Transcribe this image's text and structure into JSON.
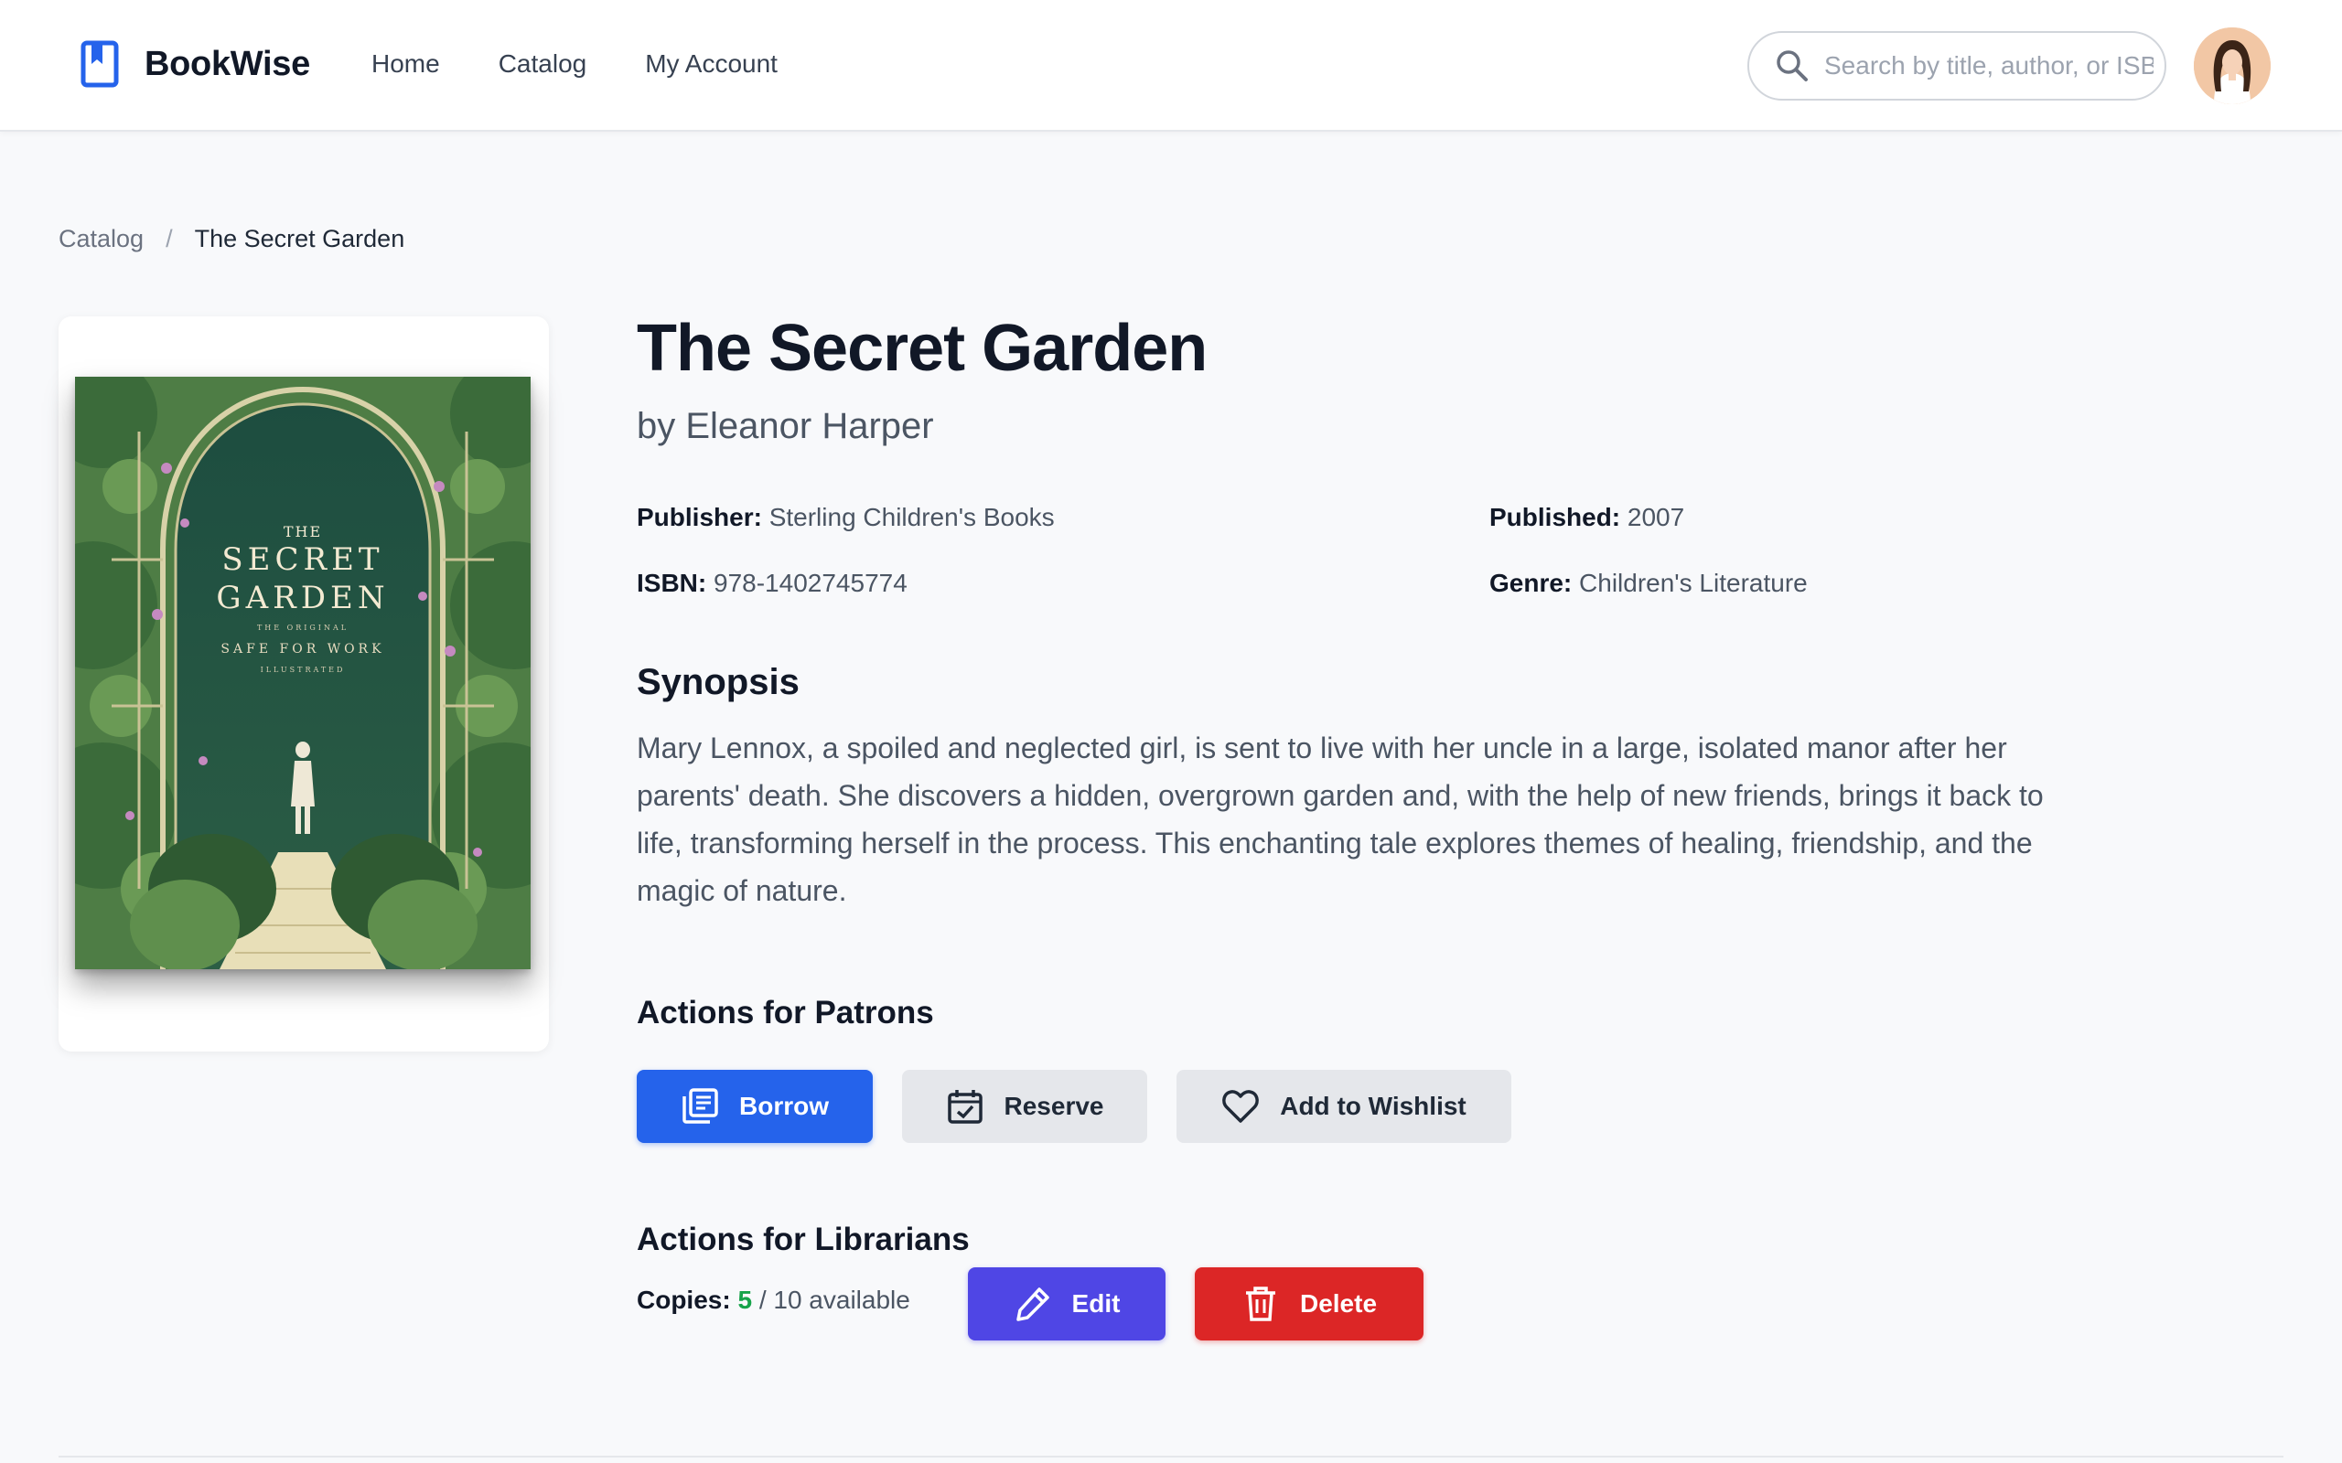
{
  "app": {
    "name": "BookWise"
  },
  "nav": [
    {
      "label": "Home"
    },
    {
      "label": "Catalog"
    },
    {
      "label": "My Account"
    }
  ],
  "search": {
    "placeholder": "Search by title, author, or ISBN",
    "value": ""
  },
  "breadcrumb": {
    "parent": "Catalog",
    "separator": "/",
    "current": "The Secret Garden"
  },
  "book": {
    "title": "The Secret Garden",
    "author": "by Eleanor Harper",
    "publisher_label": "Publisher:",
    "publisher": "Sterling Children's Books",
    "published_label": "Published:",
    "published": "2007",
    "isbn_label": "ISBN:",
    "isbn": "978-1402745774",
    "genre_label": "Genre:",
    "genre": "Children's Literature",
    "cover": {
      "line1": "THE",
      "line2": "SECRET",
      "line3": "GARDEN",
      "small1": "THE ORIGINAL",
      "tagline": "SAFE FOR WORK",
      "small2": "ILLUSTRATED"
    }
  },
  "synopsis": {
    "heading": "Synopsis",
    "text": "Mary Lennox, a spoiled and neglected girl, is sent to live with her uncle in a large, isolated manor after her parents' death. She discovers a hidden, overgrown garden and, with the help of new friends, brings it back to life, transforming herself in the process. This enchanting tale explores themes of healing, friendship, and the magic of nature."
  },
  "patron_actions": {
    "heading": "Actions for Patrons",
    "borrow": "Borrow",
    "reserve": "Reserve",
    "wishlist": "Add to Wishlist"
  },
  "librarian_actions": {
    "heading": "Actions for Librarians",
    "copies_label": "Copies:",
    "copies_available": "5",
    "copies_total": "/ 10 available",
    "edit": "Edit",
    "delete": "Delete"
  },
  "colors": {
    "primary": "#2563eb",
    "indigo": "#4f46e5",
    "danger": "#dc2626",
    "success": "#16a34a"
  }
}
